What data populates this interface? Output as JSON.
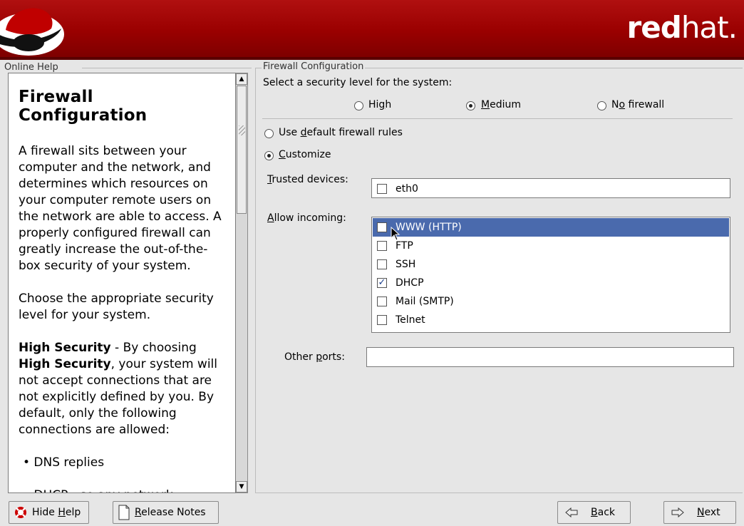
{
  "brand": {
    "bold": "red",
    "light": "hat."
  },
  "help": {
    "frame_label": "Online Help",
    "title": "Firewall Configuration",
    "paragraphs": [
      "A firewall sits between your computer and the network, and determines which resources on your computer remote users on the network are able to access. A properly configured firewall can greatly increase the out-of-the-box security of your system.",
      "Choose the appropriate security level for your system."
    ],
    "high_a": "High Security",
    "high_b": " - By choosing ",
    "high_c": "High Security",
    "high_d": ", your system will not accept connections that are not explicitly defined by you. By default, only the following connections are allowed:",
    "bullets": [
      "• DNS replies",
      "• DHCP - so any network"
    ]
  },
  "firewall": {
    "frame_label": "Firewall Configuration",
    "security_prompt": "Select a security level for the system:",
    "levels": [
      {
        "pre": "Hi",
        "ul": "g",
        "post": "h",
        "selected": false
      },
      {
        "pre": "",
        "ul": "M",
        "post": "edium",
        "selected": true
      },
      {
        "pre": "N",
        "ul": "o",
        "post": " firewall",
        "selected": false
      }
    ],
    "rule_options": [
      {
        "pre": "Use ",
        "ul": "d",
        "post": "efault firewall rules",
        "selected": false
      },
      {
        "pre": "",
        "ul": "C",
        "post": "ustomize",
        "selected": true
      }
    ],
    "trusted_label_ul": "T",
    "trusted_label_rest": "rusted devices:",
    "trusted_devices": [
      {
        "name": "eth0",
        "checked": false
      }
    ],
    "incoming_label_ul": "A",
    "incoming_label_rest": "llow incoming:",
    "incoming": [
      {
        "name": "WWW (HTTP)",
        "checked": false,
        "selected": true
      },
      {
        "name": "FTP",
        "checked": false,
        "selected": false
      },
      {
        "name": "SSH",
        "checked": false,
        "selected": false
      },
      {
        "name": "DHCP",
        "checked": true,
        "selected": false
      },
      {
        "name": "Mail (SMTP)",
        "checked": false,
        "selected": false
      },
      {
        "name": "Telnet",
        "checked": false,
        "selected": false
      }
    ],
    "other_ports_pre": "Other ",
    "other_ports_ul": "p",
    "other_ports_post": "orts:",
    "other_ports_value": ""
  },
  "buttons": {
    "hide_help_pre": "Hide ",
    "hide_help_ul": "H",
    "hide_help_post": "elp",
    "release_ul": "R",
    "release_post": "elease Notes",
    "back_ul": "B",
    "back_post": "ack",
    "next_ul": "N",
    "next_post": "ext"
  },
  "colors": {
    "banner": "#9a0000",
    "selection": "#4a6aad"
  }
}
